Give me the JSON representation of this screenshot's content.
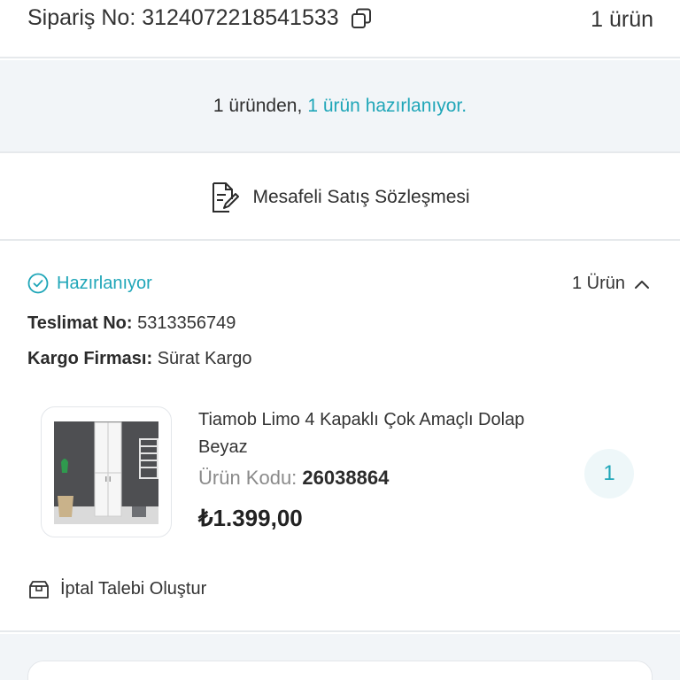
{
  "header": {
    "order_label": "Sipariş No: 3124072218541533",
    "item_count": "1 ürün"
  },
  "status_banner": {
    "prefix": "1 üründen,",
    "highlight": "1 ürün hazırlanıyor."
  },
  "contract": {
    "label": "Mesafeli Satış Sözleşmesi"
  },
  "shipment": {
    "status": "Hazırlanıyor",
    "product_count": "1 Ürün",
    "delivery_label": "Teslimat No:",
    "delivery_value": "5313356749",
    "carrier_label": "Kargo Firması:",
    "carrier_value": "Sürat Kargo"
  },
  "product": {
    "title": "Tiamob Limo 4 Kapaklı Çok Amaçlı Dolap Beyaz",
    "code_label": "Ürün Kodu:",
    "code_value": "26038864",
    "price": "₺1.399,00",
    "quantity": "1"
  },
  "actions": {
    "cancel_label": "İptal Talebi Oluştur"
  },
  "colors": {
    "accent": "#1fa6b8",
    "banner_bg": "#f2f5f8"
  }
}
